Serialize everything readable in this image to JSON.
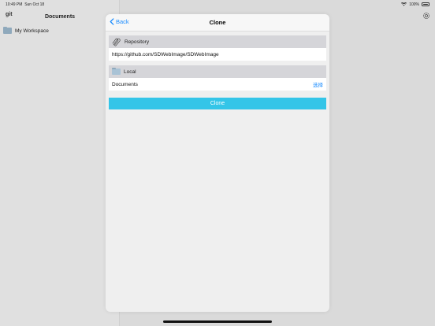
{
  "status_bar": {
    "time": "10:49 PM",
    "date": "Sun Oct 18",
    "battery": "100%"
  },
  "sidebar": {
    "logo": "git",
    "title": "Documents",
    "items": [
      {
        "label": "My Workspace"
      }
    ]
  },
  "modal": {
    "back_label": "Back",
    "title": "Clone",
    "repository": {
      "header": "Repository",
      "url": "https://github.com/SDWebImage/SDWebImage"
    },
    "local": {
      "header": "Local",
      "location": "Documents",
      "choose_label": "选择"
    },
    "clone_button": "Clone"
  },
  "colors": {
    "accent": "#1a8cff",
    "button": "#34c5e8"
  }
}
